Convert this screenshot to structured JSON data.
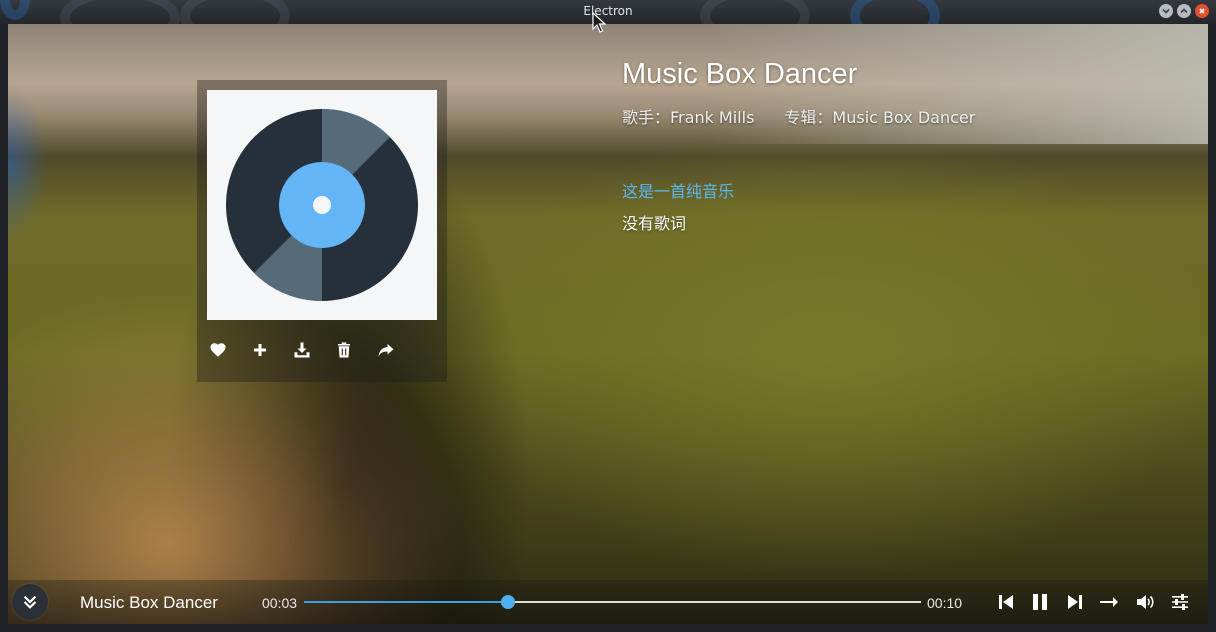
{
  "window": {
    "title": "Electron",
    "controls": {
      "minimize": "minimize",
      "maximize": "maximize",
      "close": "close"
    }
  },
  "song": {
    "title": "Music Box Dancer",
    "artist_label": "歌手：",
    "artist": "Frank Mills",
    "album_label": "专辑：",
    "album": "Music Box Dancer"
  },
  "lyrics": {
    "line1": "这是一首纯音乐",
    "line2": "没有歌词"
  },
  "cover_actions": [
    {
      "name": "like",
      "icon": "heart-icon"
    },
    {
      "name": "add",
      "icon": "plus-icon"
    },
    {
      "name": "download",
      "icon": "download-icon"
    },
    {
      "name": "delete",
      "icon": "trash-icon"
    },
    {
      "name": "share",
      "icon": "share-icon"
    }
  ],
  "player": {
    "now_playing": "Music Box Dancer",
    "current_time": "00:03",
    "total_time": "00:10",
    "progress": 0.33,
    "controls": [
      "previous-icon",
      "pause-icon",
      "next-icon",
      "sequence-mode-icon",
      "volume-icon",
      "equalizer-icon"
    ]
  },
  "colors": {
    "accent": "#39a0e6",
    "lyric_highlight": "#5cb6f3",
    "close_button": "#e2502f"
  }
}
